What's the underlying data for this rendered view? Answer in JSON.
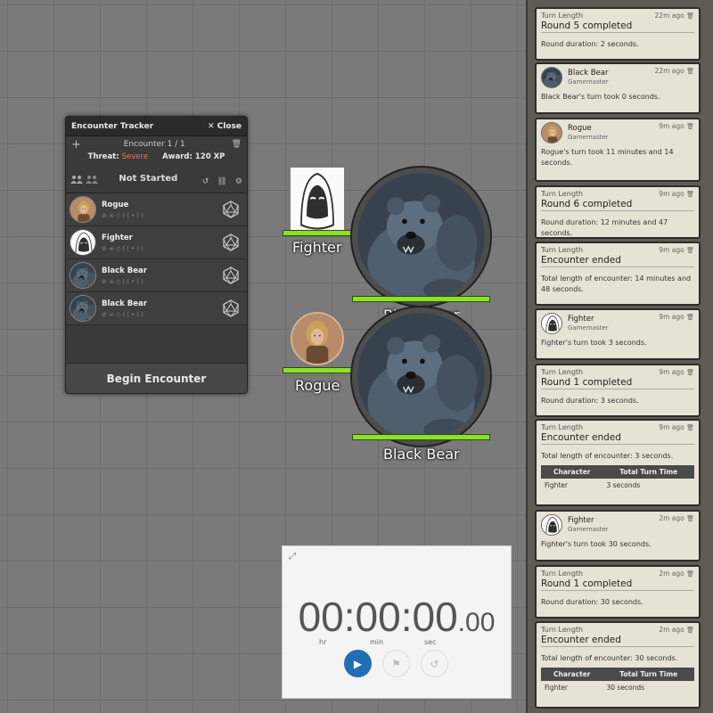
{
  "tracker": {
    "title": "Encounter Tracker",
    "close_label": "Close",
    "encounter_label": "Encounter 1 / 1",
    "threat_label": "Threat:",
    "threat_value": "Severe",
    "award_label": "Award: 120 XP",
    "status": "Not Started",
    "begin_label": "Begin Encounter",
    "combatants": [
      {
        "name": "Rogue"
      },
      {
        "name": "Fighter"
      },
      {
        "name": "Black Bear"
      },
      {
        "name": "Black Bear"
      }
    ]
  },
  "map": {
    "fighter_label": "Fighter",
    "rogue_label": "Rogue",
    "bear_label": "Black Bear",
    "bear_label_partial": "Black Bear",
    "hp": {
      "fighter": 1.0,
      "rogue": 1.0,
      "bear1": 1.0,
      "bear2": 1.0
    }
  },
  "stopwatch": {
    "hh": "00",
    "mm": "00",
    "ss": "00",
    "cs": ".00",
    "unit_hr": "hr",
    "unit_min": "min",
    "unit_sec": "sec"
  },
  "chat": {
    "messages": [
      {
        "kind": "turn",
        "heading": "Turn Length",
        "time": "22m ago",
        "title": "Round 5 completed",
        "body": "Round duration: 2 seconds."
      },
      {
        "kind": "speaker",
        "avatar": "bear",
        "name": "Black Bear",
        "sub": "Gamemaster",
        "time": "22m ago",
        "body": "Black Bear's turn took 0 seconds."
      },
      {
        "kind": "speaker",
        "avatar": "rogue",
        "name": "Rogue",
        "sub": "Gamemaster",
        "time": "9m ago",
        "body": "Rogue's turn took 11 minutes and 14 seconds."
      },
      {
        "kind": "turn",
        "heading": "Turn Length",
        "time": "9m ago",
        "title": "Round 6 completed",
        "body": "Round duration: 12 minutes and 47 seconds."
      },
      {
        "kind": "turn",
        "heading": "Turn Length",
        "time": "9m ago",
        "title": "Encounter ended",
        "body": "Total length of encounter: 14 minutes and 48 seconds."
      },
      {
        "kind": "speaker",
        "avatar": "fighter",
        "name": "Fighter",
        "sub": "Gamemaster",
        "time": "9m ago",
        "body": "Fighter's turn took 3 seconds."
      },
      {
        "kind": "turn",
        "heading": "Turn Length",
        "time": "9m ago",
        "title": "Round 1 completed",
        "body": "Round duration: 3 seconds."
      },
      {
        "kind": "table",
        "heading": "Turn Length",
        "time": "9m ago",
        "title": "Encounter ended",
        "body": "Total length of encounter: 3 seconds.",
        "col1": "Character",
        "col2": "Total Turn Time",
        "row_char": "Fighter",
        "row_time": "3 seconds"
      },
      {
        "kind": "speaker",
        "avatar": "fighter",
        "name": "Fighter",
        "sub": "Gamemaster",
        "time": "2m ago",
        "body": "Fighter's turn took 30 seconds."
      },
      {
        "kind": "turn",
        "heading": "Turn Length",
        "time": "2m ago",
        "title": "Round 1 completed",
        "body": "Round duration: 30 seconds."
      },
      {
        "kind": "table",
        "heading": "Turn Length",
        "time": "2m ago",
        "title": "Encounter ended",
        "body": "Total length of encounter: 30 seconds.",
        "col1": "Character",
        "col2": "Total Turn Time",
        "row_char": "Fighter",
        "row_time": "30 seconds"
      }
    ]
  },
  "colors": {
    "hp_bar": "#8be02a",
    "threat_severe": "#e8795a",
    "play_button": "#1f6fb2"
  },
  "icons": [
    "close-icon",
    "plus-icon",
    "trash-icon",
    "party-icon",
    "undo-icon",
    "link-icon",
    "gear-icon",
    "d20-icon",
    "expand-icon",
    "play-icon",
    "flag-icon",
    "reset-icon",
    "hide-icon",
    "skull-icon",
    "target-icon",
    "sound-icon"
  ]
}
